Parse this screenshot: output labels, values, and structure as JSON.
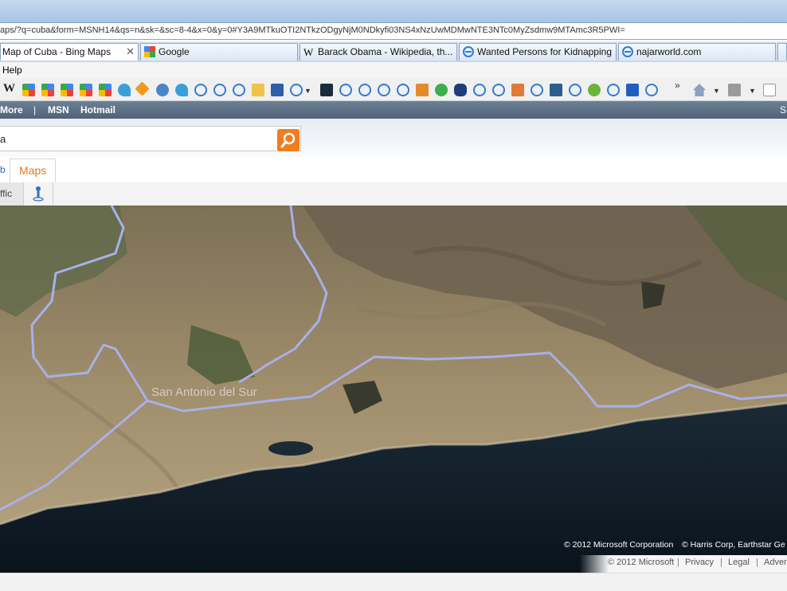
{
  "browser": {
    "address_url": "aps/?q=cuba&form=MSNH14&qs=n&sk=&sc=8-4&x=0&y=0#Y3A9MTkuOTI2NTkzODgyNjM0NDkyfi03NS4xNzUwMDMwNTE3NTc0MyZsdmw9MTAmc3R5PWI=",
    "tabs": [
      {
        "label": "Map of Cuba - Bing Maps",
        "icon": "bing-maps-icon",
        "active": true,
        "close": "✕"
      },
      {
        "label": "Google",
        "icon": "google-icon"
      },
      {
        "label": "Barack Obama - Wikipedia, th...",
        "icon": "wikipedia-icon"
      },
      {
        "label": "Wanted Persons for Kidnapping",
        "icon": "ie-page-icon"
      },
      {
        "label": "najarworld.com",
        "icon": "ie-page-icon"
      }
    ],
    "menu": {
      "help": "Help"
    },
    "chevron": "»"
  },
  "bing": {
    "nav": {
      "more": "More",
      "sep": "|",
      "msn": "MSN",
      "hotmail": "Hotmail",
      "right_initial": "S"
    },
    "search_value": "a",
    "scope_prev": "b",
    "scope_active": "Maps",
    "toolbar": {
      "traffic": "ffic"
    }
  },
  "map": {
    "place_label": "San Antonio del Sur",
    "copyright": "© 2012 Microsoft Corporation",
    "copyright2": "© Harris Corp, Earthstar Ge",
    "footer": {
      "microsoft": "© 2012 Microsoft",
      "privacy": "Privacy",
      "legal": "Legal",
      "advertise": "Adver",
      "sep": "|"
    }
  },
  "colors": {
    "bing_orange": "#f07d1f",
    "boundary": "#a8b0e8",
    "sea": "#0d1a26"
  }
}
